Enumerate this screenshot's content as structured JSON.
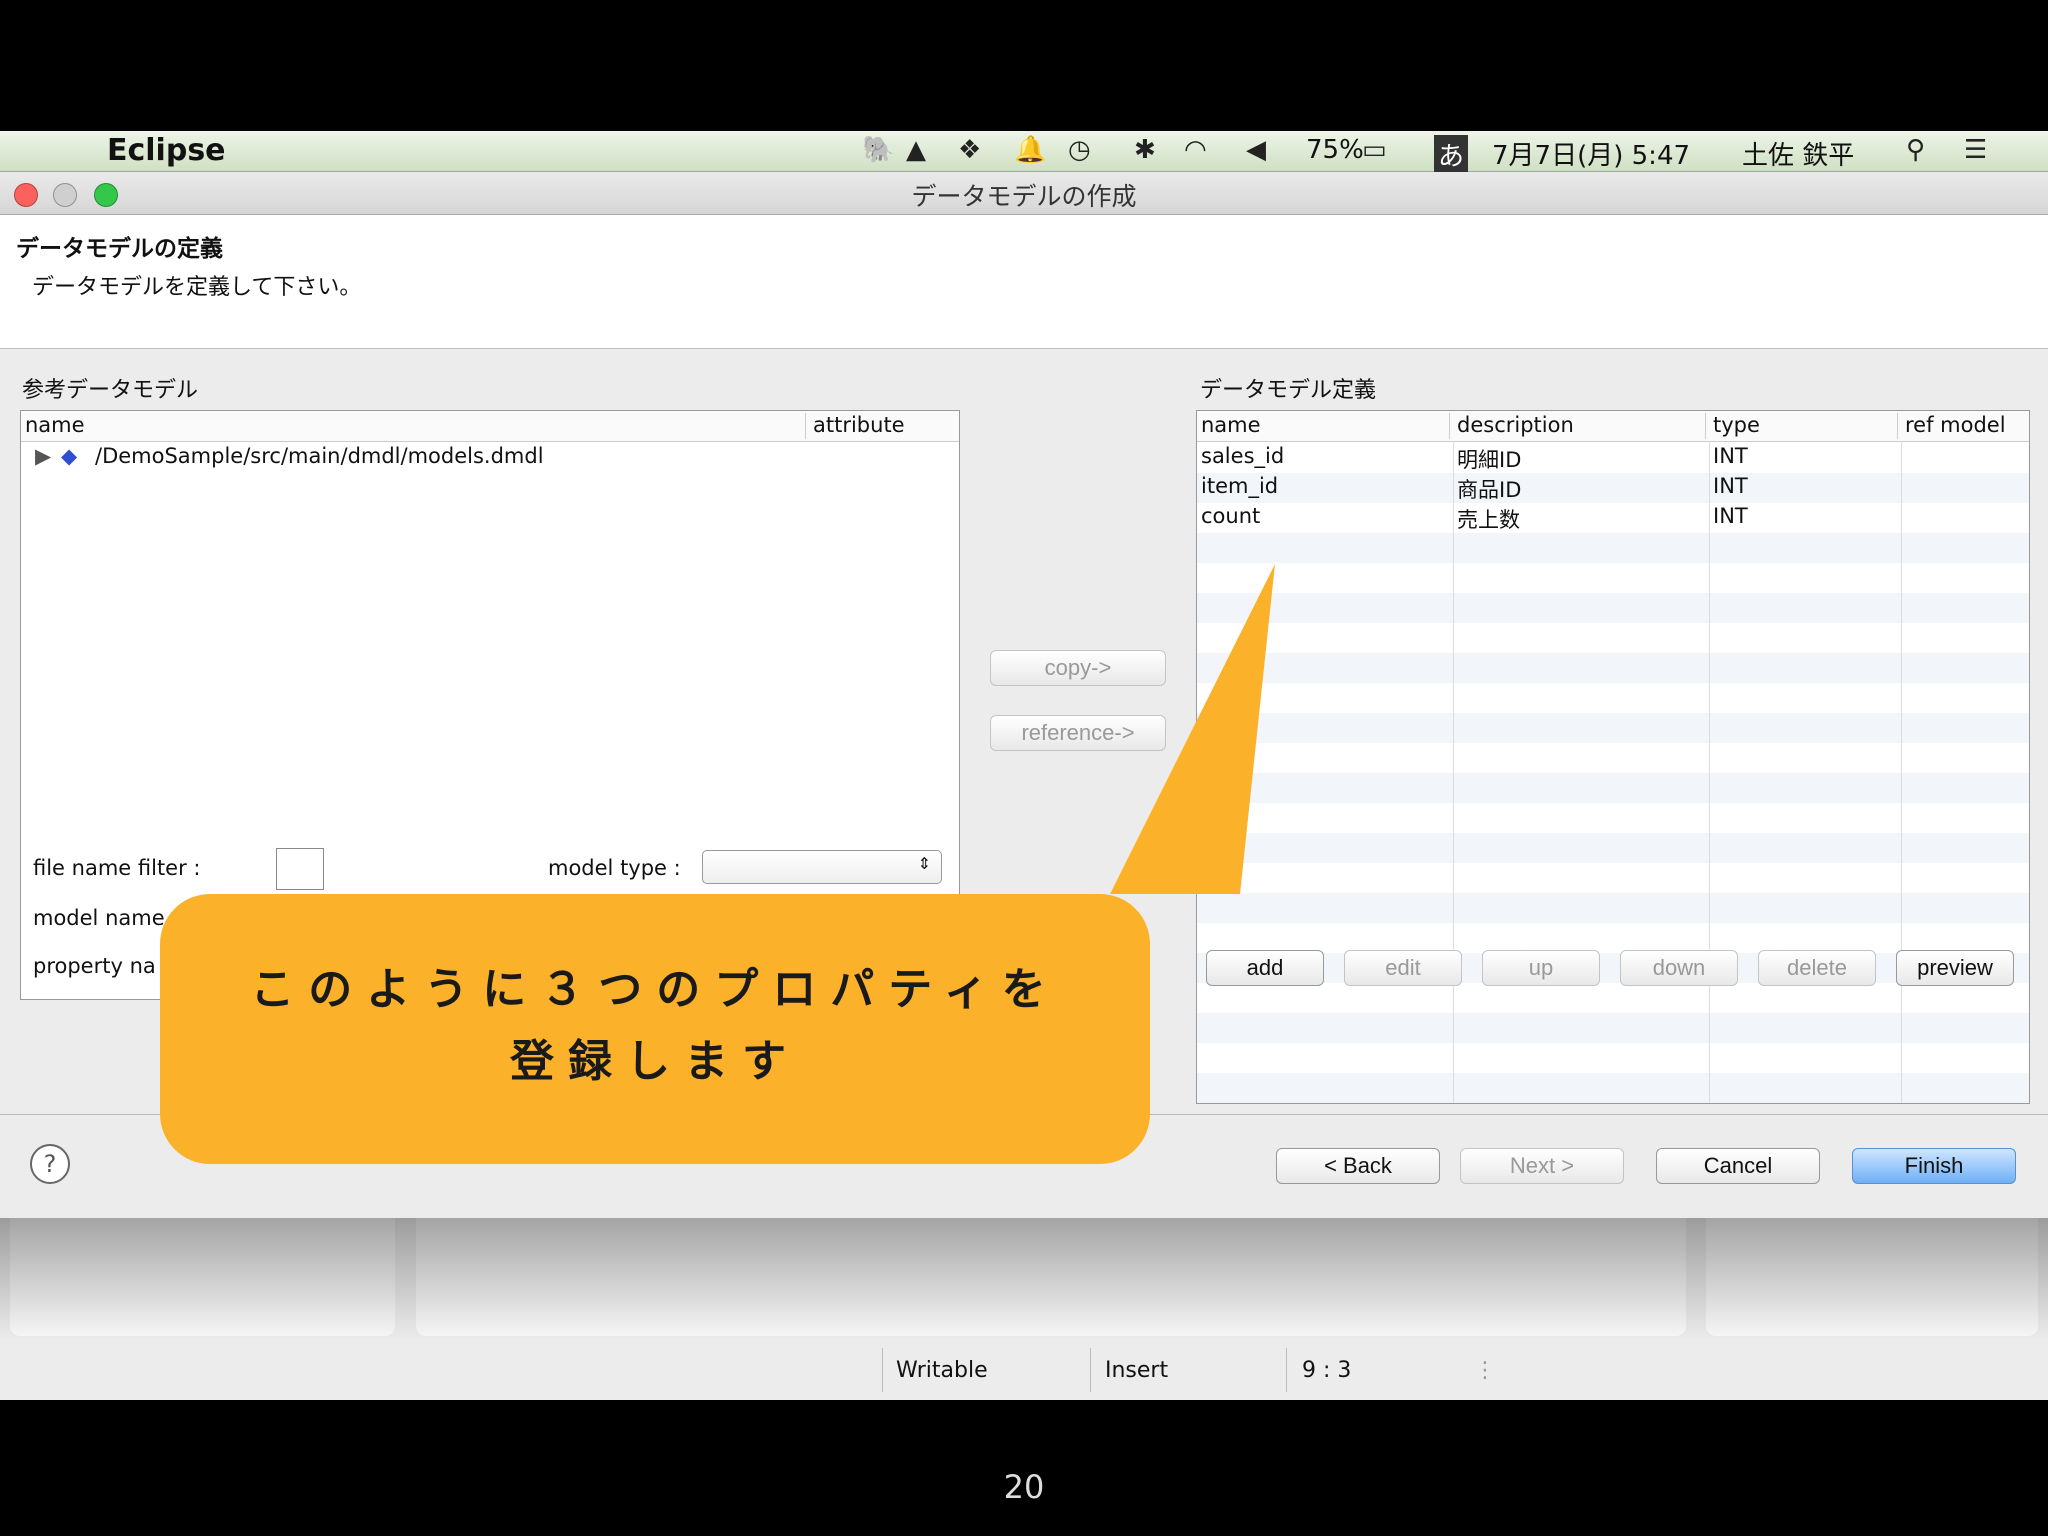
{
  "menubar": {
    "app_name": "Eclipse",
    "battery": "75%",
    "input_mode": "あ",
    "datetime": "7月7日(月) 5:47",
    "user": "土佐 鉄平"
  },
  "window": {
    "title": "データモデルの作成"
  },
  "header": {
    "title": "データモデルの定義",
    "description": "データモデルを定義して下さい。"
  },
  "left": {
    "section_label": "参考データモデル",
    "columns": [
      "name",
      "attribute"
    ],
    "tree_item": "/DemoSample/src/main/dmdl/models.dmdl",
    "file_name_filter_label": "file name filter :",
    "model_type_label": "model type :",
    "model_name_label": "model name",
    "property_name_label": "property na"
  },
  "middle": {
    "copy_label": "copy->",
    "reference_label": "reference->"
  },
  "right": {
    "section_label": "データモデル定義",
    "columns": [
      "name",
      "description",
      "type",
      "ref model"
    ],
    "rows": [
      {
        "name": "sales_id",
        "description": "明細ID",
        "type": "INT",
        "ref": ""
      },
      {
        "name": "item_id",
        "description": "商品ID",
        "type": "INT",
        "ref": ""
      },
      {
        "name": "count",
        "description": "売上数",
        "type": "INT",
        "ref": ""
      }
    ],
    "buttons": {
      "add": "add",
      "edit": "edit",
      "up": "up",
      "down": "down",
      "delete": "delete",
      "preview": "preview"
    }
  },
  "callout": {
    "line1": "このように３つのプロパティを",
    "line2": "登録します"
  },
  "footer": {
    "back": "< Back",
    "next": "Next >",
    "cancel": "Cancel",
    "finish": "Finish"
  },
  "statusbar": {
    "writable": "Writable",
    "insert": "Insert",
    "position": "9 : 3"
  },
  "slide": {
    "page_number": "20"
  },
  "colors": {
    "callout": "#fbb22a",
    "finish_button": "#6eb0f5",
    "close_light": "#fc615d",
    "minimize_light": "#fdbc40",
    "zoom_light": "#34c84a"
  }
}
